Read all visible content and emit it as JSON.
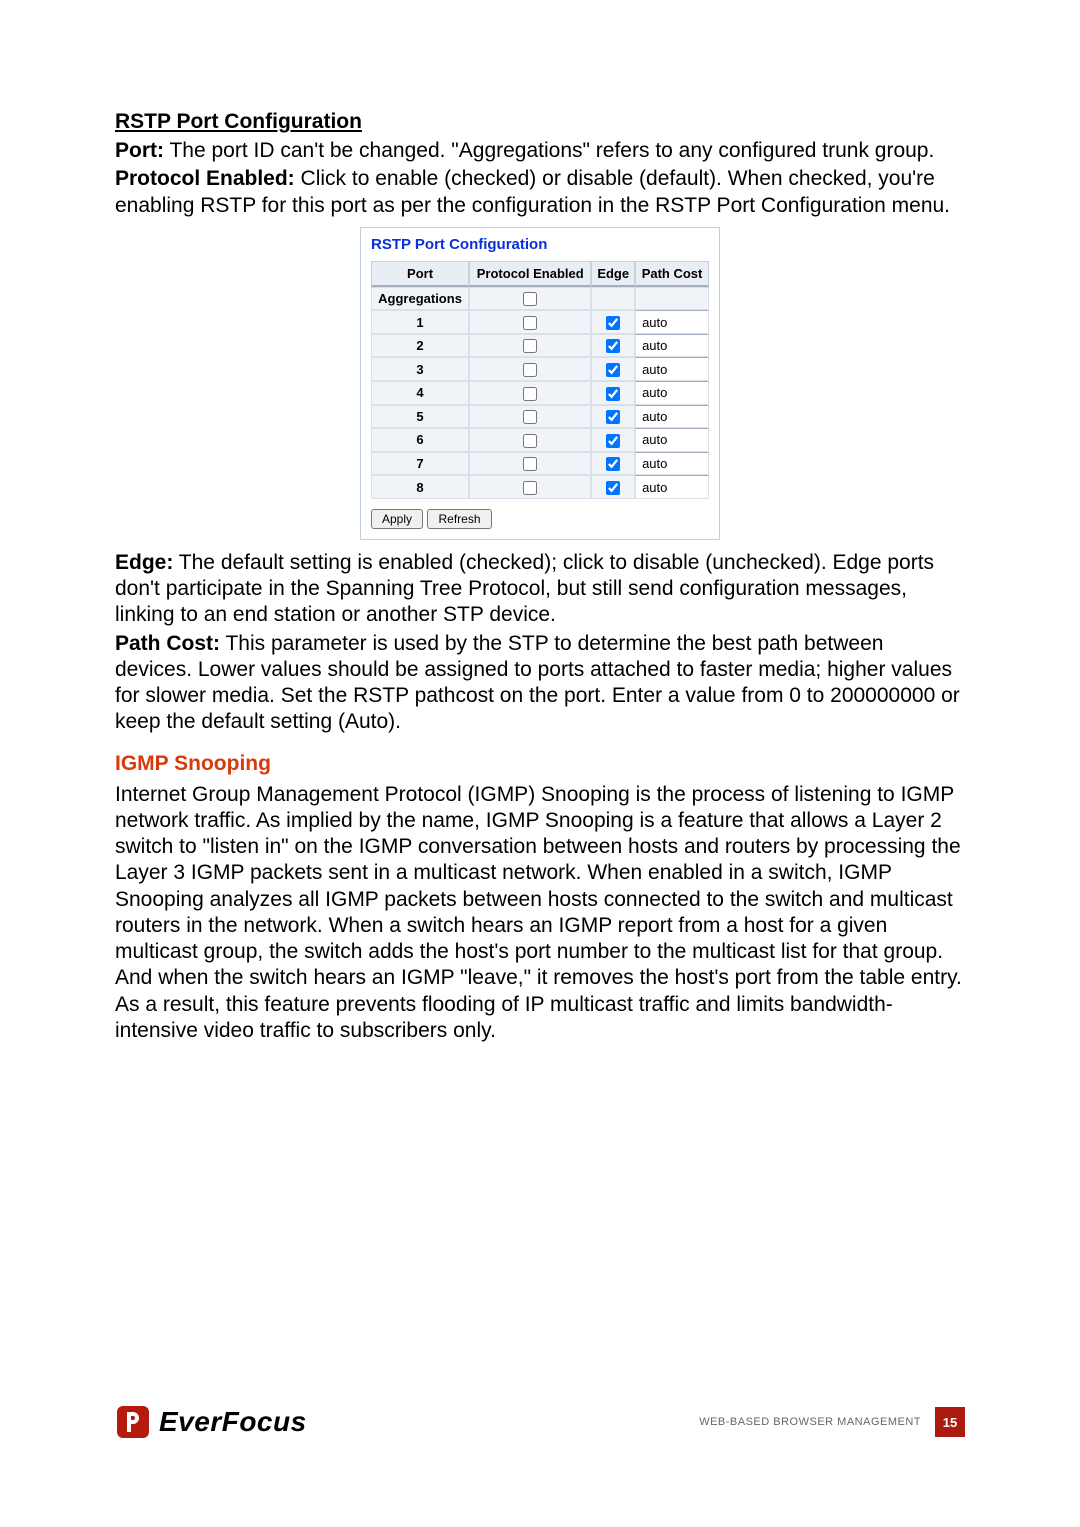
{
  "section1": {
    "title": "RSTP Port Configuration",
    "port_lead": "Port:",
    "port_body": " The port ID can't be changed. \"Aggregations\" refers to any configured trunk group.",
    "proto_lead": "Protocol Enabled:",
    "proto_body": " Click to enable (checked) or disable (default). When checked, you're enabling RSTP for this port as per the configuration in the RSTP Port Configuration menu."
  },
  "panel": {
    "title": "RSTP Port Configuration",
    "headers": {
      "port": "Port",
      "protocol_enabled": "Protocol Enabled",
      "edge": "Edge",
      "path_cost": "Path Cost"
    },
    "aggregations_label": "Aggregations",
    "buttons": {
      "apply": "Apply",
      "refresh": "Refresh"
    }
  },
  "chart_data": {
    "type": "table",
    "title": "RSTP Port Configuration",
    "columns": [
      "Port",
      "Protocol Enabled",
      "Edge",
      "Path Cost"
    ],
    "rows": [
      {
        "port": "Aggregations",
        "protocol_enabled": false,
        "edge": null,
        "path_cost": null
      },
      {
        "port": "1",
        "protocol_enabled": false,
        "edge": true,
        "path_cost": "auto"
      },
      {
        "port": "2",
        "protocol_enabled": false,
        "edge": true,
        "path_cost": "auto"
      },
      {
        "port": "3",
        "protocol_enabled": false,
        "edge": true,
        "path_cost": "auto"
      },
      {
        "port": "4",
        "protocol_enabled": false,
        "edge": true,
        "path_cost": "auto"
      },
      {
        "port": "5",
        "protocol_enabled": false,
        "edge": true,
        "path_cost": "auto"
      },
      {
        "port": "6",
        "protocol_enabled": false,
        "edge": true,
        "path_cost": "auto"
      },
      {
        "port": "7",
        "protocol_enabled": false,
        "edge": true,
        "path_cost": "auto"
      },
      {
        "port": "8",
        "protocol_enabled": false,
        "edge": true,
        "path_cost": "auto"
      }
    ]
  },
  "section2": {
    "edge_lead": "Edge:",
    "edge_body": " The default setting is enabled (checked); click to disable (unchecked). Edge ports don't participate in the Spanning Tree Protocol, but still send configuration messages, linking to an end station or another STP device.",
    "path_lead": "Path Cost:",
    "path_body": " This parameter is used by the STP to determine the best path between devices. Lower values should be assigned to ports attached to faster media; higher values for slower media. Set the RSTP pathcost on the port. Enter a value from 0 to 200000000 or keep the default setting (Auto)."
  },
  "igmp": {
    "heading": "IGMP Snooping",
    "body": "Internet Group Management Protocol (IGMP) Snooping is the process of listening to IGMP network traffic. As implied by the name, IGMP Snooping is a feature that allows a Layer 2 switch to \"listen in\" on the IGMP conversation between hosts and routers by processing the Layer 3 IGMP packets sent in a multicast network. When enabled in a switch, IGMP Snooping analyzes all IGMP packets between hosts connected to the switch and multicast routers in the network. When a switch hears an IGMP report from a host for a given multicast group, the switch adds the host's port number to the multicast list for that group. And when the switch hears an IGMP \"leave,\" it removes the host's port from the table entry. As a result, this feature prevents flooding of IP multicast traffic and limits bandwidth-intensive video traffic to subscribers only."
  },
  "footer": {
    "brand": "EverFocus",
    "label": "WEB-BASED BROWSER MANAGEMENT",
    "page": "15"
  }
}
